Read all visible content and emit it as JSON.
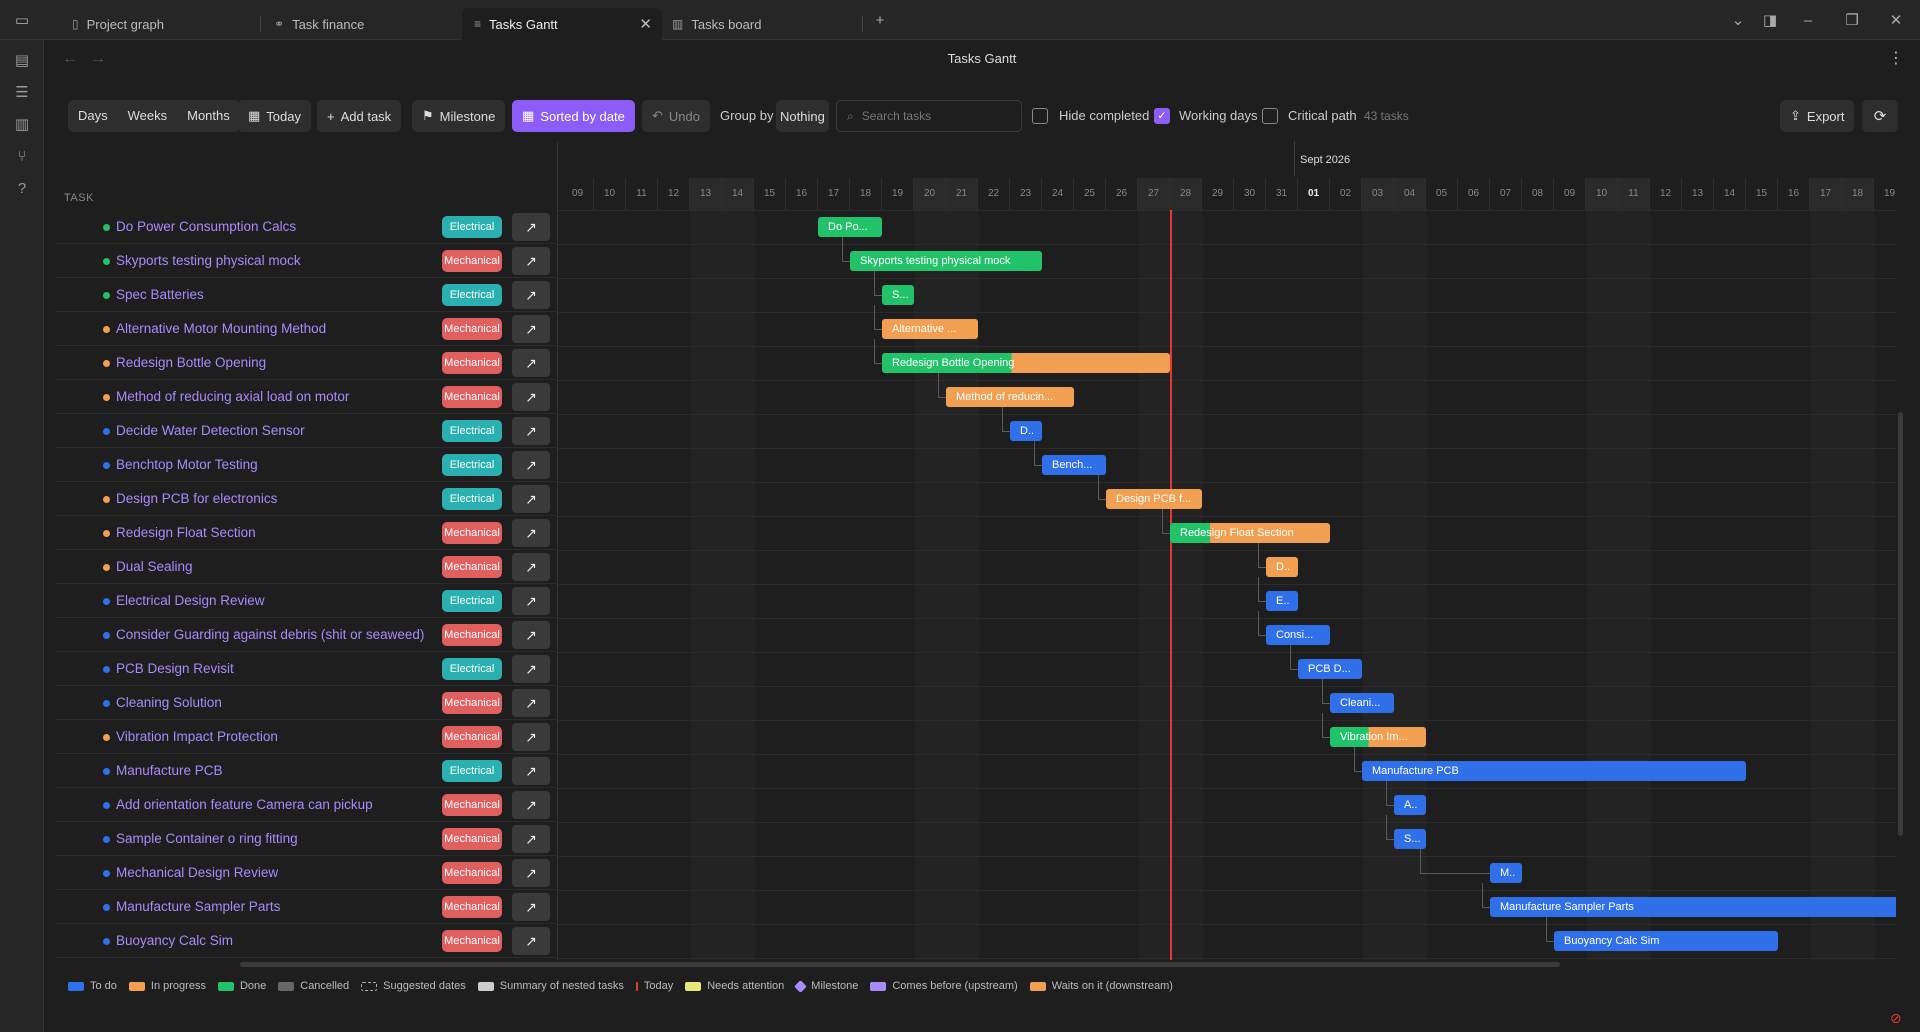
{
  "tabs": [
    {
      "label": "Project graph",
      "icon": "page-icon",
      "active": false
    },
    {
      "label": "Task finance",
      "icon": "link-icon",
      "active": false
    },
    {
      "label": "Tasks Gantt",
      "icon": "lines-icon",
      "active": true
    },
    {
      "label": "Tasks board",
      "icon": "board-icon",
      "active": false
    }
  ],
  "view_title": "Tasks Gantt",
  "toolbar": {
    "days": "Days",
    "weeks": "Weeks",
    "months": "Months",
    "today": "Today",
    "add_task": "Add task",
    "milestone": "Milestone",
    "sorted": "Sorted by date",
    "undo": "Undo",
    "group_by_label": "Group by",
    "group_by_value": "Nothing",
    "search_placeholder": "Search tasks",
    "hide_completed": "Hide completed",
    "working_days": "Working days",
    "critical_path": "Critical path",
    "task_count": "43 tasks",
    "export": "Export"
  },
  "columns": {
    "task": "TASK"
  },
  "timeline": {
    "month_label": "Sept 2026",
    "days": [
      "09",
      "10",
      "11",
      "12",
      "13",
      "14",
      "15",
      "16",
      "17",
      "18",
      "19",
      "20",
      "21",
      "22",
      "23",
      "24",
      "25",
      "26",
      "27",
      "28",
      "29",
      "30",
      "31",
      "01",
      "02",
      "03",
      "04",
      "05",
      "06",
      "07",
      "08",
      "09",
      "10",
      "11",
      "12",
      "13",
      "14",
      "15",
      "16",
      "17",
      "18",
      "19"
    ]
  },
  "colors": {
    "todo": "#2f6fe8",
    "progress": "#f0a050",
    "done": "#22c26a",
    "cancelled": "#666666",
    "electrical": "#2ab0b0",
    "mechanical": "#e06060",
    "today": "#e53935",
    "accent": "#8b5cf6"
  },
  "tasks": [
    {
      "name": "Do Power Consumption Calcs",
      "tag": "Electrical",
      "status": "done",
      "bar": "Do Po...",
      "start": 8,
      "span": 2
    },
    {
      "name": "Skyports testing physical mock",
      "tag": "Mechanical",
      "status": "done",
      "bar": "Skyports testing physical mock",
      "start": 9,
      "span": 6
    },
    {
      "name": "Spec Batteries",
      "tag": "Electrical",
      "status": "done",
      "bar": "S...",
      "start": 10,
      "span": 1
    },
    {
      "name": "Alternative Motor Mounting Method",
      "tag": "Mechanical",
      "status": "progress",
      "bar": "Alternative ...",
      "start": 10,
      "span": 3
    },
    {
      "name": "Redesign Bottle Opening",
      "tag": "Mechanical",
      "status": "progress",
      "bar": "Redesign Bottle Opening",
      "start": 10,
      "span": 9,
      "split": 0.45
    },
    {
      "name": "Method of reducing axial load on motor",
      "tag": "Mechanical",
      "status": "progress",
      "bar": "Method of reducin...",
      "start": 12,
      "span": 4
    },
    {
      "name": "Decide Water Detection Sensor",
      "tag": "Electrical",
      "status": "todo",
      "bar": "D..",
      "start": 14,
      "span": 1
    },
    {
      "name": "Benchtop Motor Testing",
      "tag": "Electrical",
      "status": "todo",
      "bar": "Bench...",
      "start": 15,
      "span": 2
    },
    {
      "name": "Design PCB for electronics",
      "tag": "Electrical",
      "status": "progress",
      "bar": "Design PCB f...",
      "start": 17,
      "span": 3
    },
    {
      "name": "Redesign Float Section",
      "tag": "Mechanical",
      "status": "progress",
      "bar": "Redesign Float Section",
      "start": 19,
      "span": 5,
      "split": 0.25
    },
    {
      "name": "Dual Sealing",
      "tag": "Mechanical",
      "status": "progress",
      "bar": "D..",
      "start": 22,
      "span": 1
    },
    {
      "name": "Electrical Design Review",
      "tag": "Electrical",
      "status": "todo",
      "bar": "E..",
      "start": 22,
      "span": 1
    },
    {
      "name": "Consider Guarding against debris (shit or seaweed)",
      "tag": "Mechanical",
      "status": "todo",
      "bar": "Consi...",
      "start": 22,
      "span": 2
    },
    {
      "name": "PCB Design Revisit",
      "tag": "Electrical",
      "status": "todo",
      "bar": "PCB D...",
      "start": 23,
      "span": 2
    },
    {
      "name": "Cleaning Solution",
      "tag": "Mechanical",
      "status": "todo",
      "bar": "Cleani...",
      "start": 24,
      "span": 2
    },
    {
      "name": "Vibration Impact Protection",
      "tag": "Mechanical",
      "status": "progress",
      "bar": "Vibration Im...",
      "start": 24,
      "span": 3,
      "split": 0.4
    },
    {
      "name": "Manufacture PCB",
      "tag": "Electrical",
      "status": "todo",
      "bar": "Manufacture PCB",
      "start": 25,
      "span": 12
    },
    {
      "name": "Add orientation feature Camera can pickup",
      "tag": "Mechanical",
      "status": "todo",
      "bar": "A..",
      "start": 26,
      "span": 1
    },
    {
      "name": "Sample Container o ring fitting",
      "tag": "Mechanical",
      "status": "todo",
      "bar": "S...",
      "start": 26,
      "span": 1
    },
    {
      "name": "Mechanical Design Review",
      "tag": "Mechanical",
      "status": "todo",
      "bar": "M..",
      "start": 29,
      "span": 1
    },
    {
      "name": "Manufacture Sampler Parts",
      "tag": "Mechanical",
      "status": "todo",
      "bar": "Manufacture Sampler Parts",
      "start": 29,
      "span": 13
    },
    {
      "name": "Buoyancy Calc Sim",
      "tag": "Mechanical",
      "status": "todo",
      "bar": "Buoyancy Calc Sim",
      "start": 31,
      "span": 7
    }
  ],
  "legend": [
    {
      "label": "To do",
      "color": "#2f6fe8"
    },
    {
      "label": "In progress",
      "color": "#f0a050"
    },
    {
      "label": "Done",
      "color": "#22c26a"
    },
    {
      "label": "Cancelled",
      "color": "#666666"
    },
    {
      "label": "Suggested dates",
      "color": "dashed"
    },
    {
      "label": "Summary of nested tasks",
      "color": "#cccccc"
    },
    {
      "label": "Today",
      "color": "#e53935"
    },
    {
      "label": "Needs attention",
      "color": "#e8e87a"
    },
    {
      "label": "Milestone",
      "color": "#a78bfa"
    },
    {
      "label": "Comes before (upstream)",
      "color": "#a78bfa"
    },
    {
      "label": "Waits on it (downstream)",
      "color": "#f0a050"
    }
  ]
}
